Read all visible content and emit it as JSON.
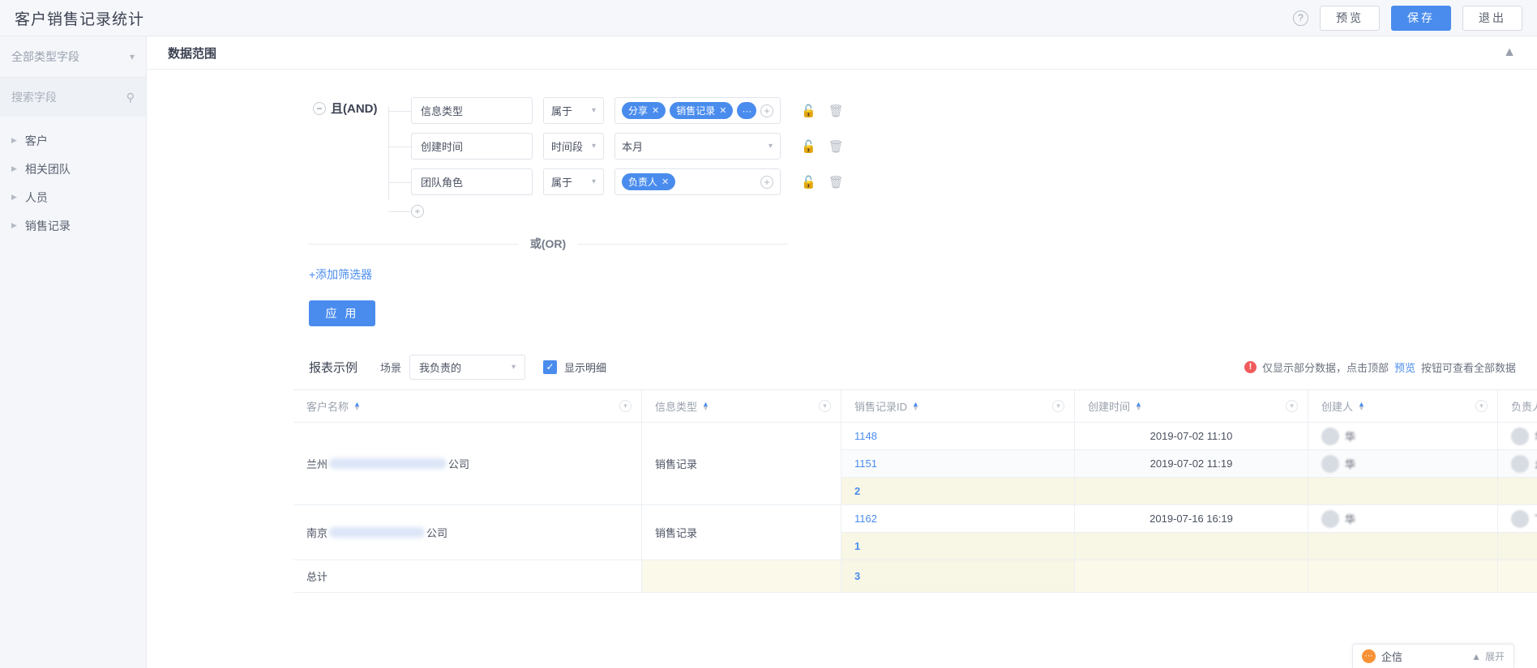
{
  "header": {
    "title": "客户销售记录统计",
    "help_icon": "question-icon",
    "buttons": [
      {
        "label": "预览",
        "style": "default"
      },
      {
        "label": "保存",
        "style": "primary"
      },
      {
        "label": "退出",
        "style": "default"
      }
    ]
  },
  "sidebar": {
    "type_select": "全部类型字段",
    "search_placeholder": "搜索字段",
    "items": [
      {
        "label": "客户"
      },
      {
        "label": "相关团队"
      },
      {
        "label": "人员"
      },
      {
        "label": "销售记录"
      }
    ]
  },
  "data_range": {
    "title": "数据范围",
    "logic_label": "且(AND)",
    "or_label": "或(OR)",
    "add_filter_label": "+添加筛选器",
    "apply_label": "应 用",
    "conditions": [
      {
        "field": "信息类型",
        "operator": "属于",
        "tags": [
          "分享",
          "销售记录"
        ],
        "overflow_tag": "···"
      },
      {
        "field": "创建时间",
        "operator": "时间段",
        "value": "本月"
      },
      {
        "field": "团队角色",
        "operator": "属于",
        "tags": [
          "负责人"
        ]
      }
    ]
  },
  "report": {
    "title": "报表示例",
    "scene_label": "场景",
    "scene_value": "我负责的",
    "detail_checkbox_label": "显示明细",
    "detail_checked": true,
    "warning_prefix": "仅显示部分数据，点击顶部",
    "warning_link": "预览",
    "warning_suffix": "按钮可查看全部数据",
    "columns": [
      {
        "label": "客户名称"
      },
      {
        "label": "信息类型"
      },
      {
        "label": "销售记录ID"
      },
      {
        "label": "创建时间"
      },
      {
        "label": "创建人"
      },
      {
        "label": "负责人"
      }
    ],
    "groups": [
      {
        "customer_prefix": "兰州",
        "customer_suffix": "公司",
        "info_type": "销售记录",
        "rows": [
          {
            "id": "1148",
            "created_at": "2019-07-02 11:10",
            "creator": "华",
            "owner": "华"
          },
          {
            "id": "1151",
            "created_at": "2019-07-02 11:19",
            "creator": "华",
            "owner": "幺"
          }
        ],
        "subtotal": "2"
      },
      {
        "customer_prefix": "南京",
        "customer_suffix": "公司",
        "info_type": "销售记录",
        "rows": [
          {
            "id": "1162",
            "created_at": "2019-07-16 16:19",
            "creator": "华",
            "owner": "下"
          }
        ],
        "subtotal": "1"
      }
    ],
    "total_label": "总计",
    "total_value": "3"
  },
  "chat": {
    "name": "企信",
    "expand_label": "展开"
  }
}
